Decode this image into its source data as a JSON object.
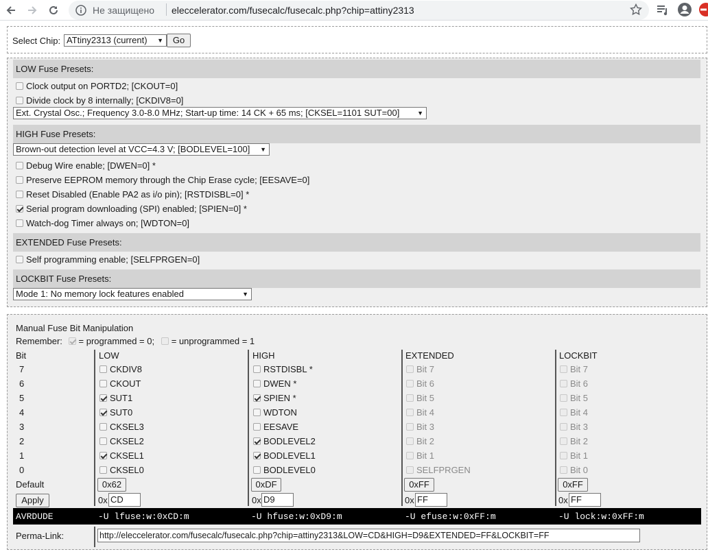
{
  "browser": {
    "security": "Не защищено",
    "url": "eleccelerator.com/fusecalc/fusecalc.php?chip=attiny2313"
  },
  "chip": {
    "label": "Select Chip:",
    "selected": "ATtiny2313 (current)",
    "go": "Go"
  },
  "presets": {
    "low": {
      "title": "LOW Fuse Presets:",
      "ckout": "Clock output on PORTD2; [CKOUT=0]",
      "ckdiv8": "Divide clock by 8 internally; [CKDIV8=0]",
      "clock_select": "Ext. Crystal Osc.; Frequency 3.0-8.0 MHz; Start-up time: 14 CK + 65 ms; [CKSEL=1101 SUT=00]"
    },
    "high": {
      "title": "HIGH Fuse Presets:",
      "bod_select": "Brown-out detection level at VCC=4.3 V; [BODLEVEL=100]",
      "dwen": "Debug Wire enable; [DWEN=0] *",
      "eesave": "Preserve EEPROM memory through the Chip Erase cycle; [EESAVE=0]",
      "rstdisbl": "Reset Disabled (Enable PA2 as i/o pin); [RSTDISBL=0] *",
      "spien": "Serial program downloading (SPI) enabled; [SPIEN=0] *",
      "wdton": "Watch-dog Timer always on; [WDTON=0]"
    },
    "extended": {
      "title": "EXTENDED Fuse Presets:",
      "selfprgen": "Self programming enable; [SELFPRGEN=0]"
    },
    "lockbit": {
      "title": "LOCKBIT Fuse Presets:",
      "mode_select": "Mode 1: No memory lock features enabled"
    }
  },
  "manual": {
    "title": "Manual Fuse Bit Manipulation",
    "remember_label": "Remember:",
    "programmed": "= programmed = 0;",
    "unprogrammed": "= unprogrammed = 1",
    "headers": [
      "Bit",
      "LOW",
      "HIGH",
      "EXTENDED",
      "LOCKBIT"
    ],
    "rows": [
      {
        "bit": "7",
        "low": "CKDIV8",
        "low_on": false,
        "high": "RSTDISBL *",
        "high_on": false,
        "ext": "Bit 7",
        "lock": "Bit 7"
      },
      {
        "bit": "6",
        "low": "CKOUT",
        "low_on": false,
        "high": "DWEN *",
        "high_on": false,
        "ext": "Bit 6",
        "lock": "Bit 6"
      },
      {
        "bit": "5",
        "low": "SUT1",
        "low_on": true,
        "high": "SPIEN *",
        "high_on": true,
        "ext": "Bit 5",
        "lock": "Bit 5"
      },
      {
        "bit": "4",
        "low": "SUT0",
        "low_on": true,
        "high": "WDTON",
        "high_on": false,
        "ext": "Bit 4",
        "lock": "Bit 4"
      },
      {
        "bit": "3",
        "low": "CKSEL3",
        "low_on": false,
        "high": "EESAVE",
        "high_on": false,
        "ext": "Bit 3",
        "lock": "Bit 3"
      },
      {
        "bit": "2",
        "low": "CKSEL2",
        "low_on": false,
        "high": "BODLEVEL2",
        "high_on": true,
        "ext": "Bit 2",
        "lock": "Bit 2"
      },
      {
        "bit": "1",
        "low": "CKSEL1",
        "low_on": true,
        "high": "BODLEVEL1",
        "high_on": true,
        "ext": "Bit 1",
        "lock": "Bit 1"
      },
      {
        "bit": "0",
        "low": "CKSEL0",
        "low_on": false,
        "high": "BODLEVEL0",
        "high_on": false,
        "ext": "SELFPRGEN",
        "lock": "Bit 0"
      }
    ],
    "default_label": "Default",
    "defaults": [
      "0x62",
      "0xDF",
      "0xFF",
      "0xFF"
    ],
    "apply": "Apply",
    "prefix": "0x",
    "values": [
      "CD",
      "D9",
      "FF",
      "FF"
    ],
    "avrdude_label": "AVRDUDE",
    "avrdude": [
      "-U lfuse:w:0xCD:m",
      "-U hfuse:w:0xD9:m",
      "-U efuse:w:0xFF:m",
      "-U lock:w:0xFF:m"
    ],
    "permalink_label": "Perma-Link:",
    "permalink": "http://eleccelerator.com/fusecalc/fusecalc.php?chip=attiny2313&LOW=CD&HIGH=D9&EXTENDED=FF&LOCKBIT=FF"
  }
}
